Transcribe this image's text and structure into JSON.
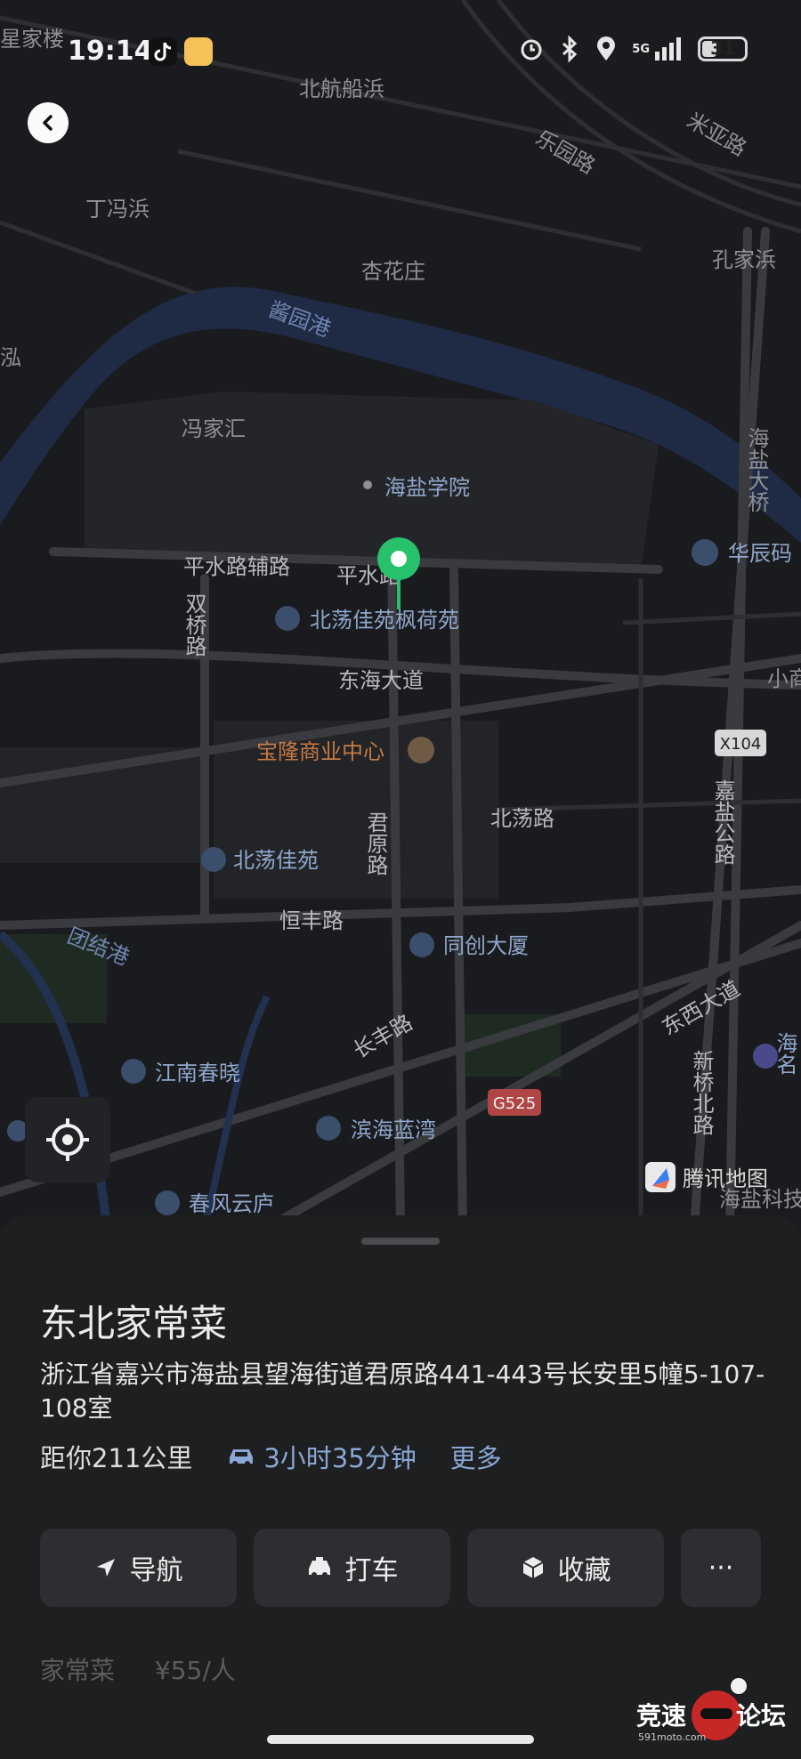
{
  "status_bar": {
    "time": "19:14",
    "network": "5G",
    "battery": "31"
  },
  "map": {
    "place_labels": {
      "beihang": "北航船浜",
      "leyuan": "乐园路",
      "miya": "米亚路",
      "dingfeng": "丁冯浜",
      "xinghua": "杏花庄",
      "kongjia": "孔家浜",
      "jiangyuan": "酱园港",
      "zhaobang": "浬浜",
      "fengjia": "冯家汇",
      "haiyan_xueyuan": "海盐学院",
      "haiyan_daqiao": "海盐大桥",
      "huachen": "华辰码",
      "pingshui_fulu": "平水路辅路",
      "pingshui": "平水路",
      "shuangqiao": "双桥路",
      "beidang_fenghe": "北荡佳苑枫荷苑",
      "donghai": "东海大道",
      "xiaoqu": "小商",
      "x104": "X104",
      "baolong": "宝隆商业中心",
      "junyuan": "君原路",
      "beidang_lu": "北荡路",
      "jiayan": "嘉盐公路",
      "beidang_jiayuan": "北荡佳苑",
      "hengfeng": "恒丰路",
      "tongchuang": "同创大厦",
      "tuanjie": "团结港",
      "dongxi": "东西大道",
      "changfeng": "长丰路",
      "xinqiao": "新桥北路",
      "jiangnan": "江南春晓",
      "g525": "G525",
      "binhai": "滨海蓝湾",
      "chunfeng": "春风云庐",
      "haiyan_keji": "海盐科技",
      "left_top": "星家楼",
      "hai_ming": "海名",
      "shuanghong": "泓"
    },
    "provider": "腾讯地图"
  },
  "place": {
    "name": "东北家常菜",
    "address": "浙江省嘉兴市海盐县望海街道君原路441-443号长安里5幢5-107-108室",
    "distance": "距你211公里",
    "drive_time": "3小时35分钟",
    "more": "更多",
    "category": "家常菜",
    "price": "¥55/人"
  },
  "actions": {
    "navigate": "导航",
    "taxi": "打车",
    "favorite": "收藏",
    "more": "···"
  },
  "watermark": {
    "text1": "竞速",
    "text2": "论坛",
    "site": "591moto.com"
  }
}
